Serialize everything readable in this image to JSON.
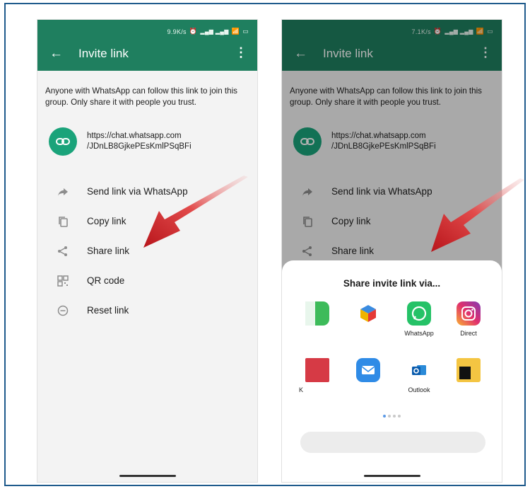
{
  "status_left": {
    "speed": "9.9K/s",
    "signal": "²³³³"
  },
  "status_right": {
    "speed": "7.1K/s"
  },
  "appbar": {
    "back": "←",
    "title": "Invite link",
    "menu": "⋮"
  },
  "description": "Anyone with WhatsApp can follow this link to join this group. Only share it with people you trust.",
  "link": {
    "line1": "https://chat.whatsapp.com",
    "line2": "/JDnLB8GjkePEsKmlPSqBFi"
  },
  "menu_items": [
    {
      "label": "Send link via WhatsApp",
      "icon": "forward-icon"
    },
    {
      "label": "Copy link",
      "icon": "copy-icon"
    },
    {
      "label": "Share link",
      "icon": "share-icon"
    },
    {
      "label": "QR code",
      "icon": "qr-icon"
    },
    {
      "label": "Reset link",
      "icon": "reset-icon"
    }
  ],
  "share_sheet": {
    "title": "Share invite link via...",
    "apps": [
      {
        "label": "",
        "icon": "app-green-icon"
      },
      {
        "label": "",
        "icon": "app-cube-icon"
      },
      {
        "label": "WhatsApp",
        "icon": "whatsapp-icon"
      },
      {
        "label": "Direct",
        "icon": "instagram-icon"
      },
      {
        "label": "K",
        "icon": "app-red-icon"
      },
      {
        "label": "",
        "icon": "mail-icon"
      },
      {
        "label": "Outlook",
        "icon": "outlook-icon"
      },
      {
        "label": "",
        "icon": "files-icon"
      }
    ],
    "page_count": 4,
    "active_page": 1
  },
  "colors": {
    "accent": "#1f7f5f",
    "link_circle": "#1aa37a",
    "arrow": "#d8262b",
    "frame": "#1f5b8c"
  }
}
